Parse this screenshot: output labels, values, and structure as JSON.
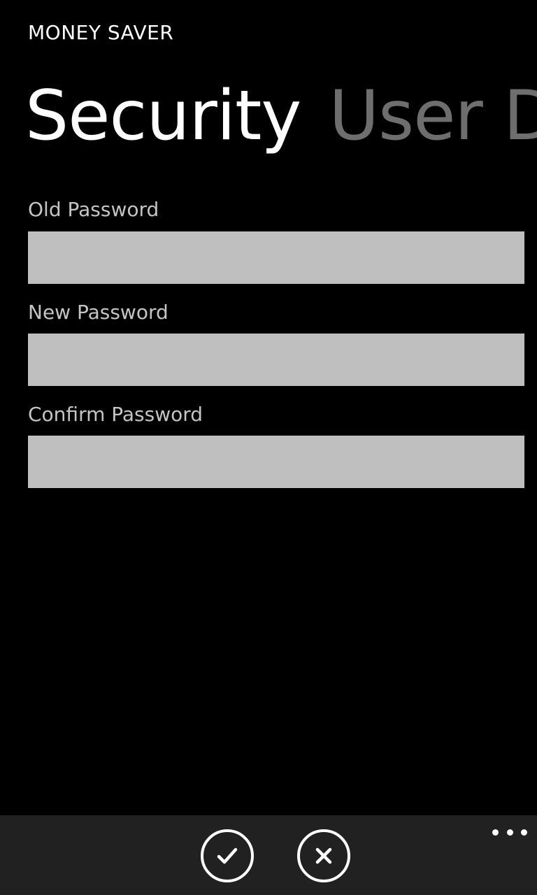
{
  "app": {
    "title": "MONEY SAVER"
  },
  "pivot": {
    "headers": [
      {
        "label": "Security",
        "active": true
      },
      {
        "label": "User Details",
        "active": false
      }
    ]
  },
  "form": {
    "old_password": {
      "label": "Old Password",
      "value": "",
      "placeholder": ""
    },
    "new_password": {
      "label": "New Password",
      "value": "",
      "placeholder": ""
    },
    "confirm_password": {
      "label": "Confirm Password",
      "value": "",
      "placeholder": ""
    }
  },
  "app_bar": {
    "buttons": [
      {
        "icon": "check-icon"
      },
      {
        "icon": "close-icon"
      }
    ],
    "more_icon": "ellipsis-icon"
  },
  "colors": {
    "background": "#000000",
    "app_bar": "#212121",
    "input_background": "#bfbfbf",
    "inactive_pivot": "#6e6e6e",
    "label": "#c4c4c4",
    "foreground": "#ffffff"
  }
}
